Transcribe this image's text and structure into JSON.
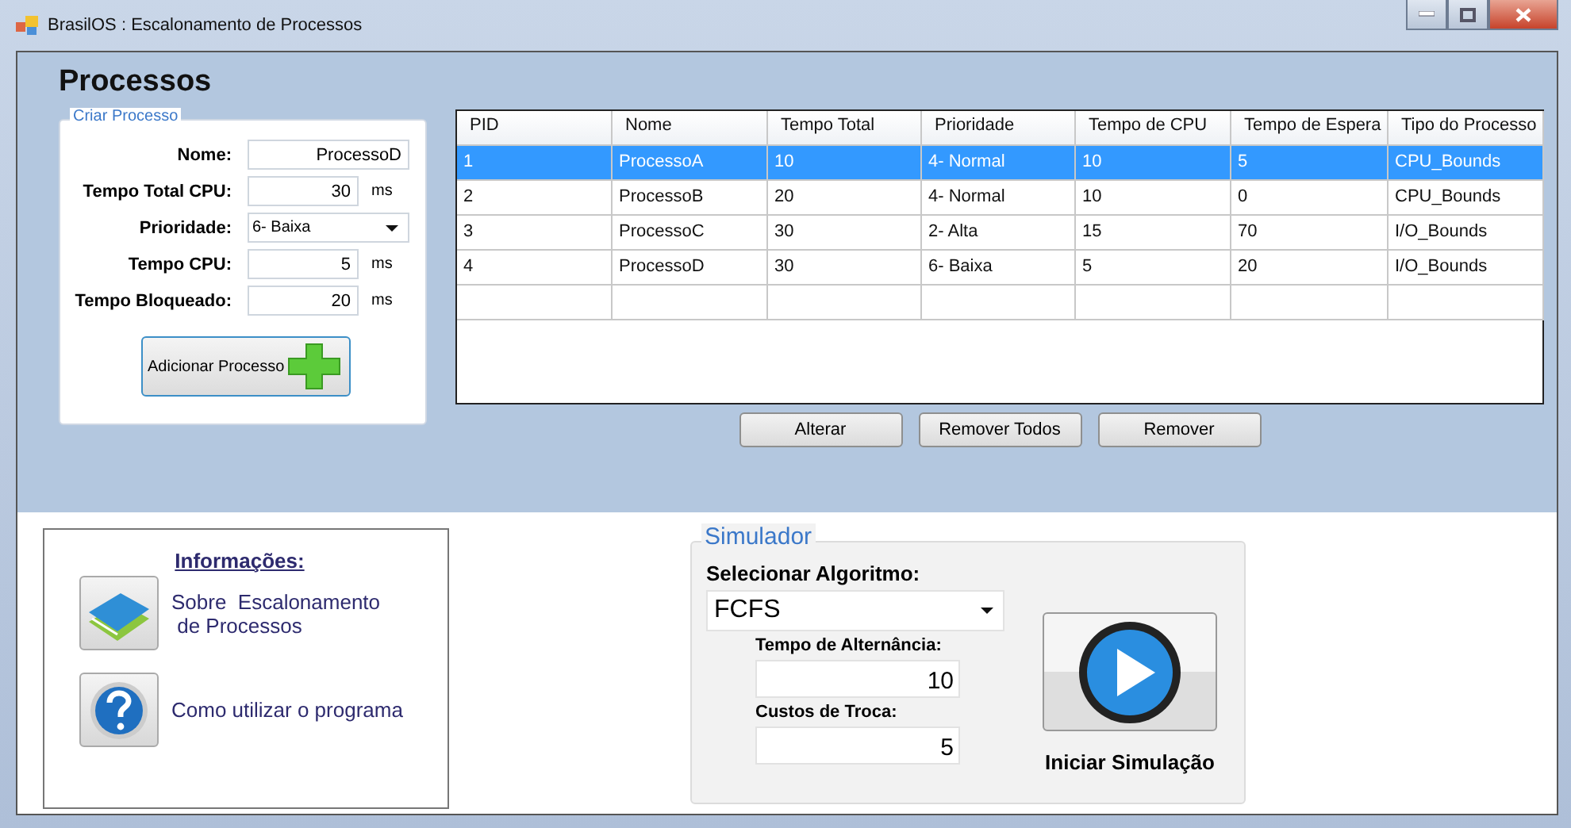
{
  "window": {
    "title": "BrasilOS :  Escalonamento de Processos"
  },
  "heading": "Processos",
  "form": {
    "legend": "Criar Processo",
    "fields": [
      {
        "kind": "text",
        "label": "Nome:",
        "value": "ProcessoD"
      },
      {
        "kind": "number",
        "label": "Tempo Total CPU:",
        "value": "30",
        "unit": "ms"
      },
      {
        "kind": "select",
        "label": "Prioridade:",
        "value": "6- Baixa"
      },
      {
        "kind": "number",
        "label": "Tempo CPU:",
        "value": "5",
        "unit": "ms"
      },
      {
        "kind": "number",
        "label": "Tempo Bloqueado:",
        "value": "20",
        "unit": "ms"
      }
    ],
    "add_button": "Adicionar Processo"
  },
  "table": {
    "columns": [
      "PID",
      "Nome",
      "Tempo Total",
      "Prioridade",
      "Tempo de CPU",
      "Tempo de Espera",
      "Tipo do Processo"
    ],
    "rows": [
      {
        "selected": true,
        "cells": [
          "1",
          "ProcessoA",
          "10",
          "4- Normal",
          "10",
          "5",
          "CPU_Bounds"
        ]
      },
      {
        "selected": false,
        "cells": [
          "2",
          "ProcessoB",
          "20",
          "4- Normal",
          "10",
          "0",
          "CPU_Bounds"
        ]
      },
      {
        "selected": false,
        "cells": [
          "3",
          "ProcessoC",
          "30",
          "2- Alta",
          "15",
          "70",
          "I/O_Bounds"
        ]
      },
      {
        "selected": false,
        "cells": [
          "4",
          "ProcessoD",
          "30",
          "6- Baixa",
          "5",
          "20",
          "I/O_Bounds"
        ]
      }
    ]
  },
  "table_buttons": [
    "Alterar",
    "Remover Todos",
    "Remover"
  ],
  "info": {
    "title": "Informações:",
    "links": [
      {
        "kind": "books",
        "text": "Sobre  Escalonamento\n de Processos"
      },
      {
        "kind": "help",
        "text": "Como utilizar o programa"
      }
    ]
  },
  "simulator": {
    "legend": "Simulador",
    "algorithm_label": "Selecionar Algoritmo:",
    "algorithm": "FCFS",
    "switch_label": "Tempo de Alternância:",
    "switch_value": "10",
    "cost_label": "Custos de Troca:",
    "cost_value": "5",
    "start_label": "Iniciar Simulação"
  }
}
